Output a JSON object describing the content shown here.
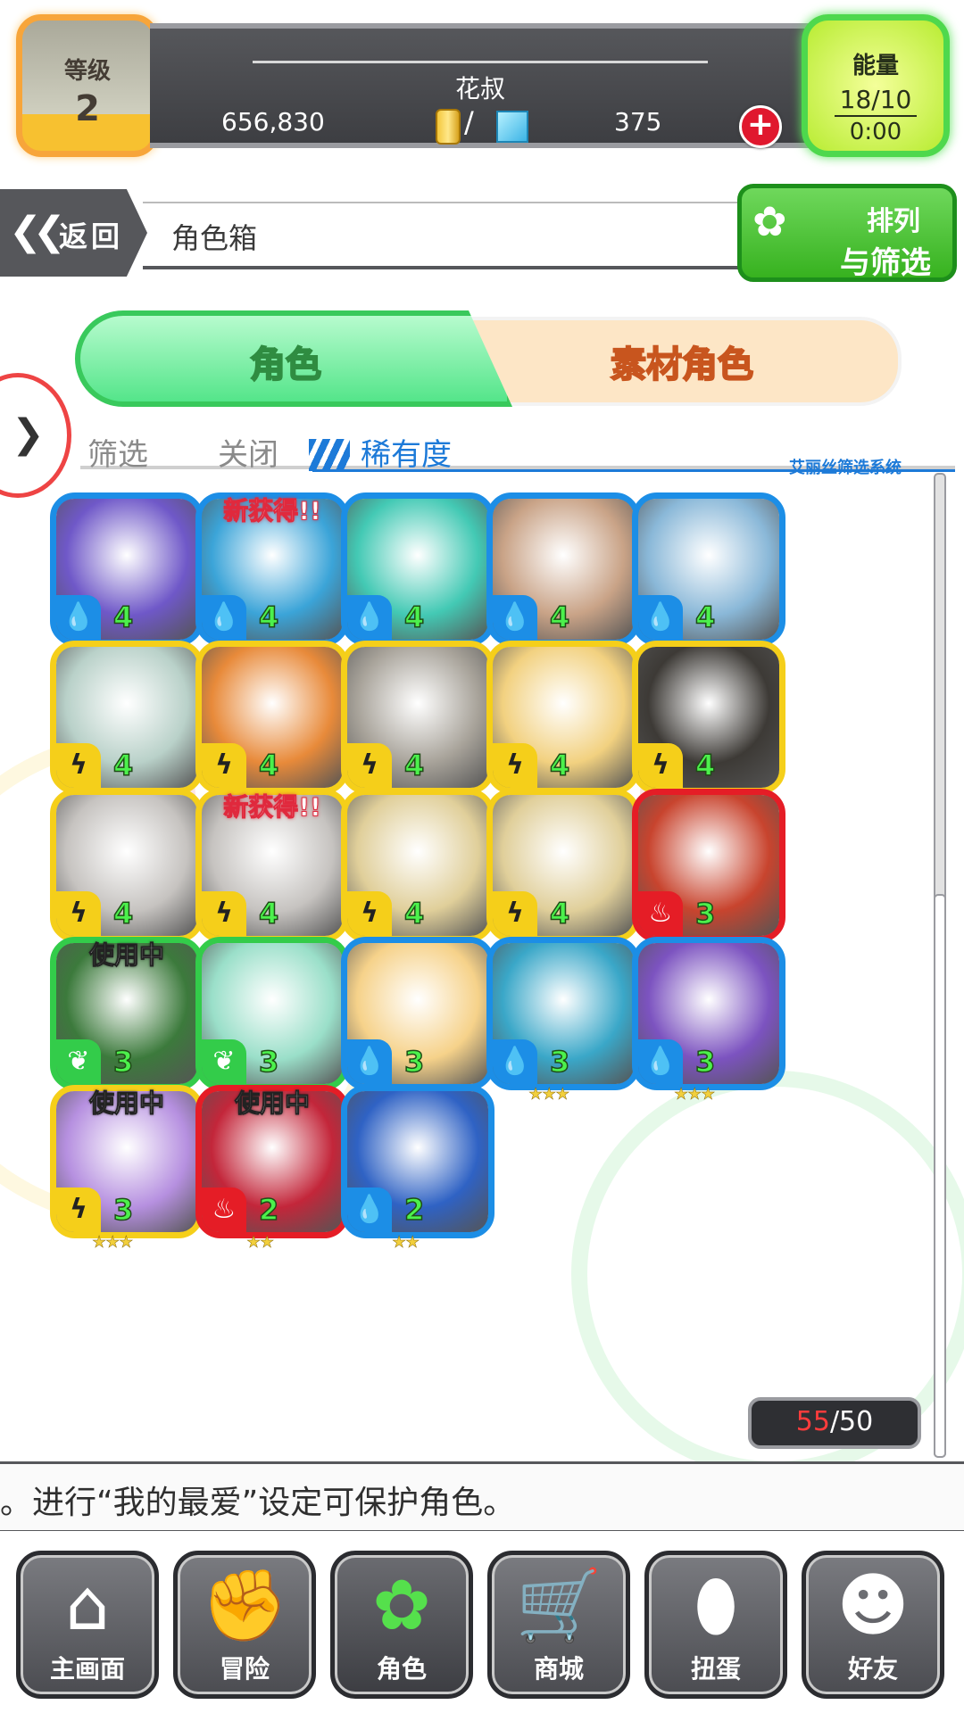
{
  "header": {
    "level_label": "等级",
    "level_value": "2",
    "username": "花叔",
    "gold": "656,830",
    "currency_separator": "/",
    "gems": "375",
    "energy_label": "能量",
    "energy_value": "18/10",
    "energy_timer": "0:00"
  },
  "nav_top": {
    "back_chevron": "❮❮",
    "back_label": "返回",
    "title": "角色箱",
    "sort_line1": "排列",
    "sort_line2": "与筛选",
    "sort_icon": "rabbit-icon"
  },
  "tabs": {
    "character": "角色",
    "material": "素材角色"
  },
  "filter": {
    "filter_label": "筛选",
    "close_label": "关闭",
    "rarity_label": "稀有度",
    "system_label": "艾丽丝筛选系统"
  },
  "colors": {
    "water": "#1c8ee6",
    "thunder": "#f5cf1a",
    "fire": "#e51d26",
    "wind": "#33cc4a",
    "accent_green": "#39c95c",
    "accent_orange": "#f08a3c"
  },
  "cards": [
    {
      "element": "water",
      "level": "4",
      "stars": "★★★★",
      "badge": "",
      "art": "#6f58c8"
    },
    {
      "element": "water",
      "level": "4",
      "stars": "★★★★",
      "badge": "新获得!!",
      "art": "#3ba4d8"
    },
    {
      "element": "water",
      "level": "4",
      "stars": "★★★★",
      "badge": "",
      "art": "#43c9b4"
    },
    {
      "element": "water",
      "level": "4",
      "stars": "★★★★",
      "badge": "",
      "art": "#c9a387"
    },
    {
      "element": "water",
      "level": "4",
      "stars": "★★★★",
      "badge": "",
      "art": "#8ab8d8"
    },
    {
      "element": "thunder",
      "level": "4",
      "stars": "★★★★",
      "badge": "",
      "art": "#b9d1c9"
    },
    {
      "element": "thunder",
      "level": "4",
      "stars": "★★★★",
      "badge": "",
      "art": "#e88a3a"
    },
    {
      "element": "thunder",
      "level": "4",
      "stars": "★★★★",
      "badge": "",
      "art": "#a8a39a"
    },
    {
      "element": "thunder",
      "level": "4",
      "stars": "★★★★",
      "badge": "",
      "art": "#f2d180"
    },
    {
      "element": "thunder",
      "level": "4",
      "stars": "★★★★",
      "badge": "",
      "art": "#3d3a36"
    },
    {
      "element": "thunder",
      "level": "4",
      "stars": "★★★★",
      "badge": "",
      "art": "#c6c3c0"
    },
    {
      "element": "thunder",
      "level": "4",
      "stars": "★★★★",
      "badge": "新获得!!",
      "art": "#c6c3c0"
    },
    {
      "element": "thunder",
      "level": "4",
      "stars": "★★★★",
      "badge": "",
      "art": "#e0cf9a"
    },
    {
      "element": "thunder",
      "level": "4",
      "stars": "★★★★",
      "badge": "",
      "art": "#e0cf9a"
    },
    {
      "element": "fire",
      "level": "3",
      "stars": "★★★",
      "badge": "",
      "art": "#c8442e"
    },
    {
      "element": "wind",
      "level": "3",
      "stars": "★★★",
      "badge": "使用中",
      "art": "#3c7a3c"
    },
    {
      "element": "wind",
      "level": "3",
      "stars": "★★★",
      "badge": "",
      "art": "#9adfc9"
    },
    {
      "element": "water",
      "level": "3",
      "stars": "★★★",
      "badge": "",
      "art": "#f6d28a"
    },
    {
      "element": "water",
      "level": "3",
      "stars": "★★★",
      "badge": "",
      "art": "#3aa7c8"
    },
    {
      "element": "water",
      "level": "3",
      "stars": "★★★",
      "badge": "",
      "art": "#7c53c0"
    },
    {
      "element": "thunder",
      "level": "3",
      "stars": "★★★",
      "badge": "使用中",
      "art": "#b690e0"
    },
    {
      "element": "fire",
      "level": "2",
      "stars": "★★",
      "badge": "使用中",
      "art": "#c3263a"
    },
    {
      "element": "water",
      "level": "2",
      "stars": "★★",
      "badge": "",
      "art": "#2f62c4"
    }
  ],
  "counter": {
    "current": "55",
    "max": "/50"
  },
  "hint": "。进行“我的最爱”设定可保护角色。",
  "bottom_nav": [
    {
      "label": "主画面",
      "icon": "home-icon",
      "glyph": "⌂"
    },
    {
      "label": "冒险",
      "icon": "handshake-icon",
      "glyph": "✊"
    },
    {
      "label": "角色",
      "icon": "rabbit-icon",
      "glyph": "✿"
    },
    {
      "label": "商城",
      "icon": "cart-icon",
      "glyph": "🛒"
    },
    {
      "label": "扭蛋",
      "icon": "egg-icon",
      "glyph": "⬮"
    },
    {
      "label": "好友",
      "icon": "friends-icon",
      "glyph": "☻"
    }
  ]
}
